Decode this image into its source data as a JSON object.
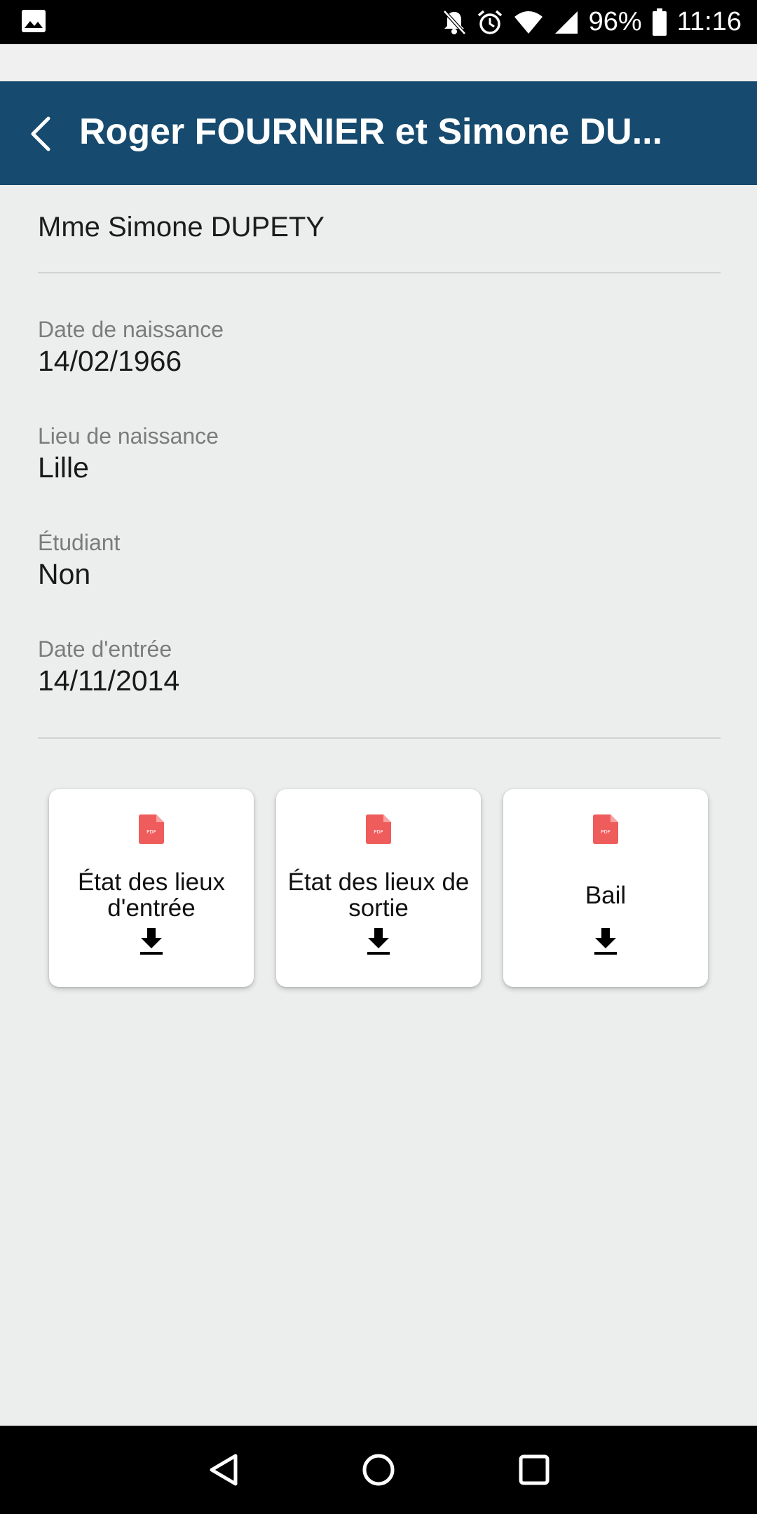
{
  "status_bar": {
    "battery": "96%",
    "time": "11:16"
  },
  "app_bar": {
    "title": "Roger FOURNIER et Simone DU..."
  },
  "person": {
    "name": "Mme Simone DUPETY"
  },
  "fields": [
    {
      "label": "Date de naissance",
      "value": "14/02/1966"
    },
    {
      "label": "Lieu de naissance",
      "value": "Lille"
    },
    {
      "label": "Étudiant",
      "value": "Non"
    },
    {
      "label": "Date d'entrée",
      "value": "14/11/2014"
    }
  ],
  "documents": [
    {
      "label": "État des lieux d'entrée",
      "icon": "pdf-file-icon",
      "action_icon": "download-icon"
    },
    {
      "label": "État des lieux de sortie",
      "icon": "pdf-file-icon",
      "action_icon": "download-icon"
    },
    {
      "label": "Bail",
      "icon": "pdf-file-icon",
      "action_icon": "download-icon"
    }
  ],
  "colors": {
    "app_bar": "#164a6e",
    "pdf_icon": "#ef5c5c",
    "background": "#eceeed"
  }
}
